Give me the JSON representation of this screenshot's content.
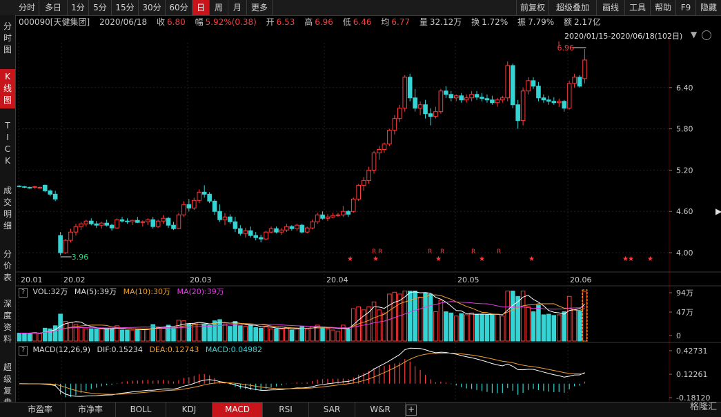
{
  "toolbar": {
    "periods": [
      "分时",
      "多日",
      "1分",
      "5分",
      "15分",
      "30分",
      "60分",
      "日",
      "周",
      "月",
      "更多"
    ],
    "active_period": "日",
    "right": [
      "前复权",
      "超级叠加",
      "画线",
      "工具",
      "帮助",
      "F9",
      "隐藏"
    ]
  },
  "info": {
    "code": "000090[天健集团]",
    "date": "2020/06/18",
    "close_label": "收",
    "close": "6.80",
    "change_label": "幅",
    "change": "5.92%(0.38)",
    "open_label": "开",
    "open": "6.53",
    "high_label": "高",
    "high": "6.96",
    "low_label": "低",
    "low": "6.46",
    "avg_label": "均",
    "avg": "6.77",
    "volume_label": "量",
    "volume": "32.12万",
    "turnover_label": "换",
    "turnover": "1.72%",
    "amplitude_label": "振",
    "amplitude": "7.79%",
    "amount_label": "额",
    "amount": "2.17亿"
  },
  "range_label": "2020/01/15-2020/06/18(102日)",
  "left_tabs": [
    "分时图",
    "K线图",
    "TICK",
    "成交明细",
    "分价表",
    "深度资料",
    "超级复盘"
  ],
  "active_left_tab": "K线图",
  "bottom_tabs": [
    "市盈率",
    "市净率",
    "BOLL",
    "KDJ",
    "MACD",
    "RSI",
    "SAR",
    "W&R",
    "+"
  ],
  "active_bottom_tab": "MACD",
  "price_axis": [
    "6.40",
    "5.80",
    "5.20",
    "4.60",
    "4.00"
  ],
  "date_axis": [
    "20.01",
    "20.02",
    "20.03",
    "20.04",
    "20.05",
    "20.06"
  ],
  "annotations": {
    "high": "6.96",
    "low": "3.96"
  },
  "volume_panel": {
    "vol_label": "VOL:32万",
    "ma5_label": "MA(5):39万",
    "ma10_label": "MA(10):30万",
    "ma20_label": "MA(20):39万",
    "axis": [
      "94万",
      "47万",
      "0"
    ]
  },
  "macd_panel": {
    "title": "MACD(12,26,9)",
    "dif": "DIF:0.15234",
    "dea": "DEA:0.12743",
    "macd": "MACD:0.04982",
    "axis": [
      "0.42731",
      "0.12261",
      "-0.18120"
    ]
  },
  "watermark": "格隆汇",
  "colors": {
    "up": "#ff3b3b",
    "down": "#35d4d4",
    "accent": "#c8151b",
    "ma10": "#f0a030",
    "ma20": "#e040e0"
  },
  "chart_data": {
    "type": "candlestick",
    "title": "000090 天健集团 日K",
    "ylim": [
      3.8,
      7.05
    ],
    "candles": [
      [
        4.97,
        4.98,
        4.95,
        4.96
      ],
      [
        4.96,
        4.97,
        4.94,
        4.95
      ],
      [
        4.95,
        4.96,
        4.93,
        4.94
      ],
      [
        4.96,
        4.97,
        4.93,
        4.96
      ],
      [
        4.95,
        4.96,
        4.94,
        4.95
      ],
      [
        4.98,
        4.99,
        4.88,
        4.9
      ],
      [
        4.9,
        4.92,
        4.82,
        4.85
      ],
      [
        4.85,
        4.9,
        4.75,
        4.78
      ],
      [
        4.25,
        4.3,
        3.96,
        4.0
      ],
      [
        4.0,
        4.2,
        3.98,
        4.18
      ],
      [
        4.18,
        4.35,
        4.15,
        4.3
      ],
      [
        4.3,
        4.42,
        4.25,
        4.38
      ],
      [
        4.38,
        4.45,
        4.33,
        4.42
      ],
      [
        4.42,
        4.48,
        4.38,
        4.46
      ],
      [
        4.46,
        4.5,
        4.4,
        4.42
      ],
      [
        4.42,
        4.46,
        4.36,
        4.4
      ],
      [
        4.4,
        4.45,
        4.35,
        4.43
      ],
      [
        4.43,
        4.48,
        4.38,
        4.4
      ],
      [
        4.4,
        4.42,
        4.32,
        4.36
      ],
      [
        4.36,
        4.5,
        4.35,
        4.48
      ],
      [
        4.48,
        4.52,
        4.44,
        4.46
      ],
      [
        4.46,
        4.5,
        4.42,
        4.45
      ],
      [
        4.45,
        4.48,
        4.4,
        4.47
      ],
      [
        4.47,
        4.52,
        4.43,
        4.44
      ],
      [
        4.44,
        4.47,
        4.38,
        4.45
      ],
      [
        4.45,
        4.5,
        4.4,
        4.48
      ],
      [
        4.48,
        4.52,
        4.35,
        4.38
      ],
      [
        4.38,
        4.48,
        4.36,
        4.46
      ],
      [
        4.46,
        4.55,
        4.42,
        4.5
      ],
      [
        4.5,
        4.52,
        4.36,
        4.4
      ],
      [
        4.4,
        4.45,
        4.33,
        4.35
      ],
      [
        4.35,
        4.58,
        4.34,
        4.55
      ],
      [
        4.55,
        4.75,
        4.52,
        4.7
      ],
      [
        4.7,
        4.78,
        4.6,
        4.65
      ],
      [
        4.65,
        4.8,
        4.62,
        4.76
      ],
      [
        4.76,
        4.92,
        4.72,
        4.88
      ],
      [
        4.88,
        4.98,
        4.8,
        4.85
      ],
      [
        4.85,
        4.88,
        4.72,
        4.75
      ],
      [
        4.75,
        4.78,
        4.55,
        4.6
      ],
      [
        4.6,
        4.7,
        4.45,
        4.48
      ],
      [
        4.48,
        4.58,
        4.4,
        4.52
      ],
      [
        4.52,
        4.56,
        4.42,
        4.45
      ],
      [
        4.45,
        4.52,
        4.3,
        4.35
      ],
      [
        4.35,
        4.4,
        4.25,
        4.28
      ],
      [
        4.28,
        4.36,
        4.22,
        4.32
      ],
      [
        4.32,
        4.38,
        4.22,
        4.25
      ],
      [
        4.25,
        4.3,
        4.18,
        4.22
      ],
      [
        4.22,
        4.26,
        4.15,
        4.2
      ],
      [
        4.2,
        4.32,
        4.18,
        4.3
      ],
      [
        4.3,
        4.38,
        4.28,
        4.35
      ],
      [
        4.35,
        4.38,
        4.28,
        4.3
      ],
      [
        4.3,
        4.36,
        4.26,
        4.33
      ],
      [
        4.33,
        4.42,
        4.3,
        4.38
      ],
      [
        4.38,
        4.4,
        4.32,
        4.35
      ],
      [
        4.35,
        4.42,
        4.32,
        4.4
      ],
      [
        4.4,
        4.42,
        4.28,
        4.3
      ],
      [
        4.3,
        4.38,
        4.28,
        4.36
      ],
      [
        4.36,
        4.48,
        4.34,
        4.45
      ],
      [
        4.45,
        4.58,
        4.42,
        4.55
      ],
      [
        4.55,
        4.6,
        4.48,
        4.5
      ],
      [
        4.5,
        4.56,
        4.46,
        4.52
      ],
      [
        4.52,
        4.58,
        4.5,
        4.54
      ],
      [
        4.54,
        4.58,
        4.52,
        4.55
      ],
      [
        4.55,
        4.68,
        4.52,
        4.6
      ],
      [
        4.6,
        4.62,
        4.52,
        4.56
      ],
      [
        4.6,
        4.8,
        4.58,
        4.78
      ],
      [
        4.78,
        5.0,
        4.75,
        4.98
      ],
      [
        4.98,
        5.1,
        4.9,
        5.05
      ],
      [
        5.05,
        5.25,
        5.0,
        5.2
      ],
      [
        5.2,
        5.48,
        5.15,
        5.45
      ],
      [
        5.45,
        5.55,
        5.35,
        5.5
      ],
      [
        5.5,
        5.6,
        5.45,
        5.58
      ],
      [
        5.58,
        5.8,
        5.55,
        5.78
      ],
      [
        5.78,
        6.0,
        5.72,
        5.95
      ],
      [
        5.95,
        6.15,
        5.9,
        6.1
      ],
      [
        6.1,
        6.58,
        6.05,
        6.55
      ],
      [
        6.55,
        6.6,
        6.2,
        6.25
      ],
      [
        6.25,
        6.38,
        6.05,
        6.1
      ],
      [
        6.1,
        6.2,
        6.0,
        6.15
      ],
      [
        6.15,
        6.22,
        5.95,
        6.02
      ],
      [
        6.02,
        6.1,
        5.85,
        5.98
      ],
      [
        5.98,
        6.12,
        5.95,
        6.05
      ],
      [
        6.05,
        6.38,
        6.02,
        6.35
      ],
      [
        6.35,
        6.42,
        6.25,
        6.3
      ],
      [
        6.3,
        6.35,
        6.2,
        6.25
      ],
      [
        6.25,
        6.3,
        6.2,
        6.28
      ],
      [
        6.28,
        6.32,
        6.18,
        6.22
      ],
      [
        6.22,
        6.3,
        6.18,
        6.25
      ],
      [
        6.25,
        6.35,
        6.2,
        6.3
      ],
      [
        6.3,
        6.35,
        6.22,
        6.26
      ],
      [
        6.26,
        6.32,
        6.2,
        6.24
      ],
      [
        6.24,
        6.3,
        6.18,
        6.22
      ],
      [
        6.22,
        6.28,
        6.15,
        6.18
      ],
      [
        6.18,
        6.25,
        6.12,
        6.22
      ],
      [
        6.22,
        6.28,
        6.18,
        6.25
      ],
      [
        6.25,
        6.78,
        6.2,
        6.72
      ],
      [
        6.72,
        6.75,
        6.1,
        6.15
      ],
      [
        6.15,
        6.22,
        5.8,
        5.92
      ],
      [
        5.92,
        6.4,
        5.85,
        6.35
      ],
      [
        6.35,
        6.55,
        6.3,
        6.5
      ],
      [
        6.5,
        6.55,
        6.38,
        6.42
      ],
      [
        6.42,
        6.48,
        6.2,
        6.25
      ],
      [
        6.25,
        6.3,
        6.18,
        6.22
      ],
      [
        6.22,
        6.28,
        6.15,
        6.2
      ],
      [
        6.2,
        6.26,
        6.15,
        6.18
      ],
      [
        6.18,
        6.24,
        6.12,
        6.2
      ],
      [
        6.2,
        6.22,
        6.05,
        6.1
      ],
      [
        6.1,
        6.5,
        6.08,
        6.46
      ],
      [
        6.46,
        6.6,
        6.4,
        6.55
      ],
      [
        6.55,
        6.58,
        6.4,
        6.42
      ],
      [
        6.53,
        6.96,
        6.46,
        6.8
      ]
    ]
  }
}
